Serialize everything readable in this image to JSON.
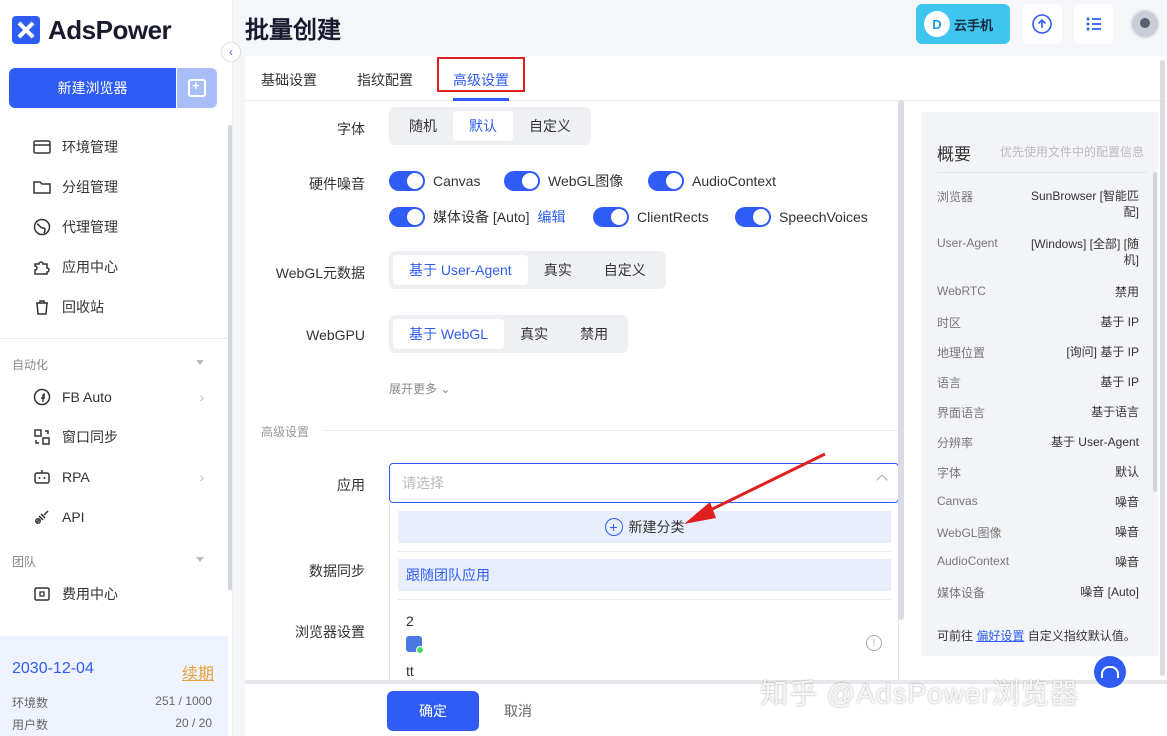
{
  "app": {
    "logo_text": "AdsPower",
    "page_title": "批量创建"
  },
  "sidebar": {
    "new_browser_label": "新建浏览器",
    "items": [
      {
        "label": "环境管理",
        "icon": "window-icon"
      },
      {
        "label": "分组管理",
        "icon": "folder-icon"
      },
      {
        "label": "代理管理",
        "icon": "globe-icon"
      },
      {
        "label": "应用中心",
        "icon": "puzzle-icon"
      },
      {
        "label": "回收站",
        "icon": "trash-icon"
      }
    ],
    "section_automation": "自动化",
    "automation_items": [
      {
        "label": "FB Auto",
        "icon": "facebook-icon"
      },
      {
        "label": "窗口同步",
        "icon": "sync-window-icon"
      },
      {
        "label": "RPA",
        "icon": "robot-icon"
      },
      {
        "label": "API",
        "icon": "api-icon"
      }
    ],
    "section_team": "团队",
    "team_items": [
      {
        "label": "费用中心",
        "icon": "wallet-icon"
      }
    ],
    "plan": {
      "expiry": "2030-12-04",
      "renew_label": "续期",
      "env_label": "环境数",
      "env_value": "251 / 1000",
      "user_label": "用户数",
      "user_value": "20 / 20"
    }
  },
  "header": {
    "cloud_phone_label": "云手机",
    "cloud_icon_text": "D"
  },
  "tabs": [
    {
      "label": "基础设置"
    },
    {
      "label": "指纹配置"
    },
    {
      "label": "高级设置"
    }
  ],
  "form": {
    "font_label": "字体",
    "font_options": [
      "随机",
      "默认",
      "自定义"
    ],
    "noise_label": "硬件噪音",
    "noise_toggles": [
      "Canvas",
      "WebGL图像",
      "AudioContext",
      "媒体设备 [Auto]",
      "ClientRects",
      "SpeechVoices"
    ],
    "edit_label": "编辑",
    "webgl_meta_label": "WebGL元数据",
    "webgl_meta_options": [
      "基于 User-Agent",
      "真实",
      "自定义"
    ],
    "webgpu_label": "WebGPU",
    "webgpu_options": [
      "基于 WebGL",
      "真实",
      "禁用"
    ],
    "expand_more": "展开更多",
    "advanced_section": "高级设置",
    "app_label": "应用",
    "app_placeholder": "请选择",
    "data_sync_label": "数据同步",
    "browser_settings_label": "浏览器设置",
    "dropdown": {
      "new_category": "新建分类",
      "follow_team": "跟随团队应用",
      "item1": "2",
      "item2": "tt",
      "info_glyph": "!"
    },
    "confirm_label": "确定",
    "cancel_label": "取消"
  },
  "summary": {
    "title": "概要",
    "hint": "优先使用文件中的配置信息",
    "rows": [
      {
        "key": "浏览器",
        "value": "SunBrowser [智能匹配]"
      },
      {
        "key": "User-Agent",
        "value": "[Windows] [全部] [随机]"
      },
      {
        "key": "WebRTC",
        "value": "禁用"
      },
      {
        "key": "时区",
        "value": "基于 IP"
      },
      {
        "key": "地理位置",
        "value": "[询问] 基于 IP"
      },
      {
        "key": "语言",
        "value": "基于 IP"
      },
      {
        "key": "界面语言",
        "value": "基于语言"
      },
      {
        "key": "分辨率",
        "value": "基于 User-Agent"
      },
      {
        "key": "字体",
        "value": "默认"
      },
      {
        "key": "Canvas",
        "value": "噪音"
      },
      {
        "key": "WebGL图像",
        "value": "噪音"
      },
      {
        "key": "AudioContext",
        "value": "噪音"
      },
      {
        "key": "媒体设备",
        "value": "噪音 [Auto]"
      }
    ],
    "footer_prefix": "可前往",
    "footer_link": "偏好设置",
    "footer_suffix": "自定义指纹默认值。"
  },
  "watermark": "知乎 @AdsPower浏览器",
  "colors": {
    "accent": "#2f5cf5",
    "highlight_box": "#e02020",
    "arrow": "#e02020",
    "cloud_button": "#3ec6f0"
  }
}
